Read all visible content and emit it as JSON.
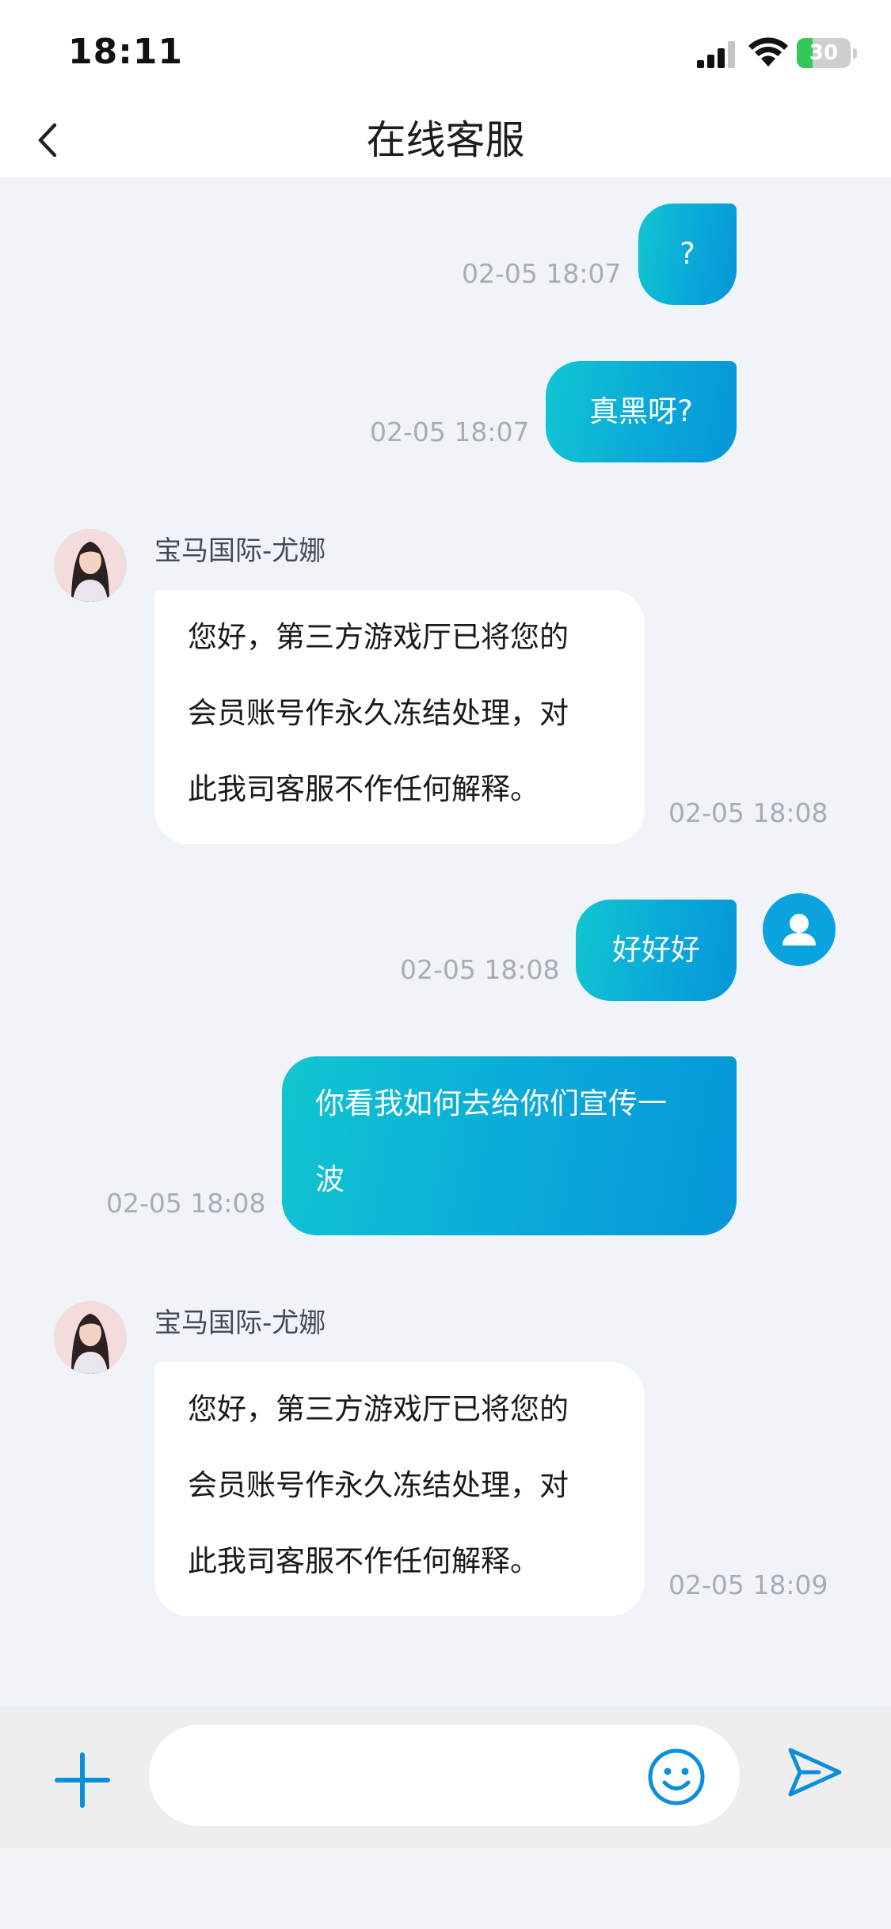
{
  "status_bar": {
    "time": "18:11",
    "battery_level": "30",
    "battery_fraction": 0.3,
    "signal_icon": "cellular-signal-icon",
    "wifi_icon": "wifi-icon",
    "battery_icon": "battery-charging-icon"
  },
  "nav": {
    "title": "在线客服",
    "back_icon": "chevron-left-icon"
  },
  "chat": {
    "messages": [
      {
        "direction": "out",
        "text": "?",
        "time": "02-05 18:07"
      },
      {
        "direction": "out",
        "text": "真黑呀?",
        "time": "02-05 18:07"
      },
      {
        "direction": "in",
        "sender": "宝马国际-尤娜",
        "text": "您好，第三方游戏厅已将您的\n会员账号作永久冻结处理，对\n此我司客服不作任何解释。",
        "time": "02-05 18:08"
      },
      {
        "direction": "out",
        "text": "好好好",
        "time": "02-05 18:08"
      },
      {
        "direction": "out",
        "text": "你看我如何去给你们宣传一\n波",
        "time": "02-05 18:08"
      },
      {
        "direction": "in",
        "sender": "宝马国际-尤娜",
        "text": "您好，第三方游戏厅已将您的\n会员账号作永久冻结处理，对\n此我司客服不作任何解释。",
        "time": "02-05 18:09"
      }
    ]
  },
  "input_bar": {
    "placeholder": "",
    "value": "",
    "plus_icon": "plus-icon",
    "emoji_icon": "smiley-icon",
    "send_icon": "send-icon"
  },
  "colors": {
    "accent": "#0aa3df",
    "outgoing_gradient_start": "#10c6d0",
    "outgoing_gradient_end": "#0596d9",
    "chat_background": "#f0f4f9",
    "battery_green": "#34c759"
  }
}
